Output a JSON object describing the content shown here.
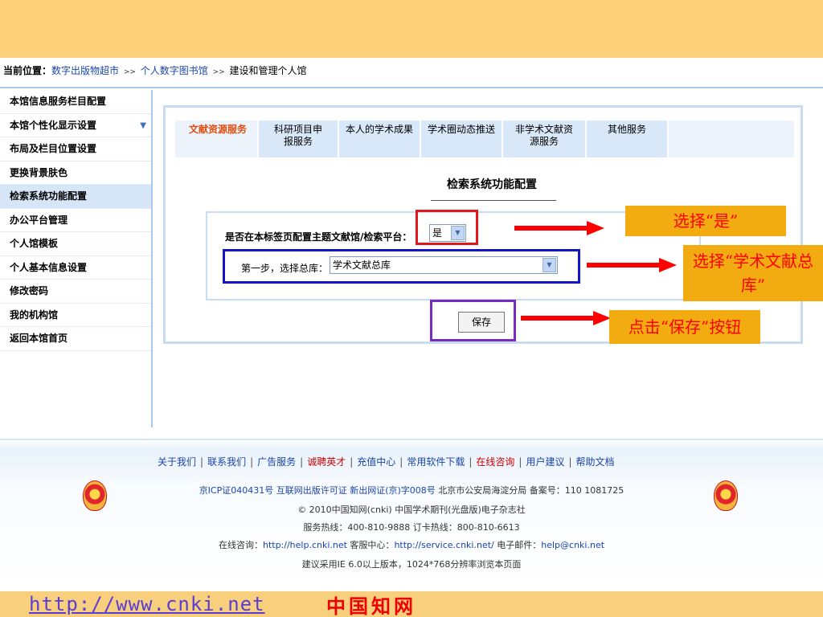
{
  "breadcrumb": {
    "label": "当前位置：",
    "sep": ">>",
    "items": [
      "数字出版物超市",
      "个人数字图书馆",
      "建设和管理个人馆"
    ]
  },
  "sidebar": {
    "items": [
      {
        "label": "本馆信息服务栏目配置"
      },
      {
        "label": "本馆个性化显示设置"
      },
      {
        "label": "布局及栏目位置设置"
      },
      {
        "label": "更换背景肤色"
      },
      {
        "label": "检索系统功能配置"
      },
      {
        "label": "办公平台管理"
      },
      {
        "label": "个人馆模板"
      },
      {
        "label": "个人基本信息设置"
      },
      {
        "label": "修改密码"
      },
      {
        "label": "我的机构馆"
      },
      {
        "label": "返回本馆首页"
      }
    ],
    "active_index": 4
  },
  "tabs": [
    {
      "label": "文献资源服务"
    },
    {
      "label": "科研项目申报服务"
    },
    {
      "label": "本人的学术成果"
    },
    {
      "label": "学术圈动态推送"
    },
    {
      "label": "非学术文献资源服务"
    },
    {
      "label": "其他服务"
    }
  ],
  "config": {
    "title": "检索系统功能配置",
    "question": "是否在本标签页配置主题文献馆/检索平台：",
    "yes_value": "是",
    "step_label": "第一步，选择总库：",
    "library_value": "学术文献总库",
    "save_label": "保存"
  },
  "callouts": {
    "choose_yes": "选择“是”",
    "choose_library": "选择“学术文献总库”",
    "click_save": "点击“保存”按钮"
  },
  "footer": {
    "links": [
      "关于我们",
      "联系我们",
      "广告服务",
      "诚聘英才",
      "充值中心",
      "常用软件下载",
      "在线咨询",
      "用户建议",
      "帮助文档"
    ],
    "license_links": "京ICP证040431号  互联网出版许可证  新出网证(京)字008号",
    "license_text": " 北京市公安局海淀分局 备案号：110 1081725",
    "copyright": "© 2010中国知网(cnki) 中国学术期刊(光盘版)电子杂志社",
    "hotline": "服务热线：400-810-9888 订卡热线：800-810-6613",
    "consult_label": "在线咨询：",
    "help_url": "http://help.cnki.net",
    "service_label": " 客服中心：",
    "service_url": "http://service.cnki.net/",
    "email_label": " 电子邮件：",
    "email": "help@cnki.net",
    "browser_note": "建议采用IE 6.0以上版本，1024*768分辨率浏览本页面"
  },
  "brand": {
    "url": "http://www.cnki.net",
    "name": "中国知网"
  },
  "colors": {
    "background": "#fdd27a",
    "accent_blue": "#1a45a8",
    "active_tab": "#e24d10",
    "callout_fill": "#f2ac12",
    "callout_text": "#ff0000",
    "highlight_red": "#e3161b",
    "highlight_blue": "#1515c8",
    "highlight_purple": "#7a2bc0"
  }
}
